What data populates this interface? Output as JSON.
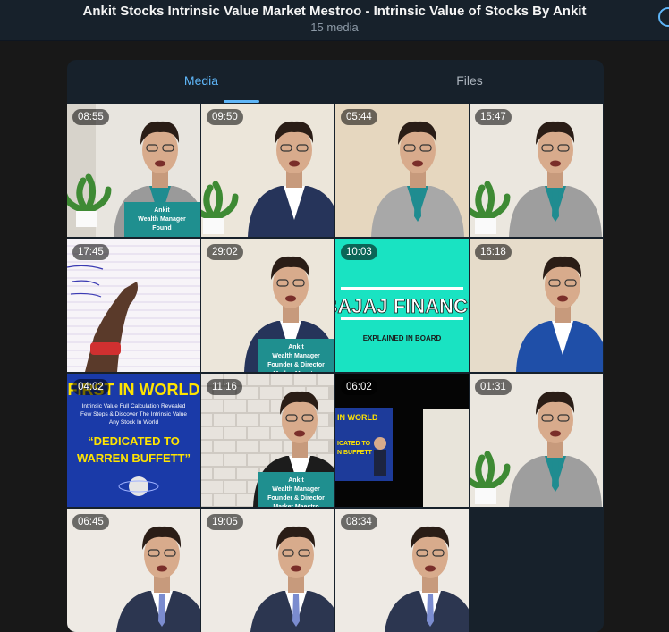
{
  "header": {
    "title": "Ankit Stocks Intrinsic Value Market Mestroo - Intrinsic Value of Stocks By Ankit",
    "subtitle": "15 media"
  },
  "tabs": [
    {
      "label": "Media",
      "active": true
    },
    {
      "label": "Files",
      "active": false
    }
  ],
  "media": [
    {
      "duration": "08:55",
      "style": "white-lower",
      "caption": [
        "Ankit",
        "Wealth Manager",
        "Found"
      ]
    },
    {
      "duration": "09:50",
      "style": "navy",
      "caption": []
    },
    {
      "duration": "05:44",
      "style": "grey",
      "caption": []
    },
    {
      "duration": "15:47",
      "style": "grey-plant",
      "caption": []
    },
    {
      "duration": "17:45",
      "style": "board",
      "caption": []
    },
    {
      "duration": "29:02",
      "style": "navy-lower",
      "caption": [
        "Ankit",
        "Wealth Manager",
        "Founder & Director",
        "Market Maestro"
      ]
    },
    {
      "duration": "10:03",
      "style": "teal-title",
      "caption": [
        "BAJAJ FINANCE",
        "EXPLAINED IN BOARD"
      ]
    },
    {
      "duration": "16:18",
      "style": "blue",
      "caption": []
    },
    {
      "duration": "04:02",
      "style": "poster",
      "caption": [
        "FIRST IN WORLD",
        "Intrinsic Value Full Calculation Revealed",
        "Few Steps & Discover The Intrinsic Value",
        "Any Stock In World",
        "“DEDICATED TO",
        "WARREN BUFFETT”"
      ]
    },
    {
      "duration": "11:16",
      "style": "brick-lower",
      "caption": [
        "Ankit",
        "Wealth Manager",
        "Founder & Director",
        "Market Maestro"
      ]
    },
    {
      "duration": "06:02",
      "style": "dark-tv",
      "caption": []
    },
    {
      "duration": "01:31",
      "style": "grey-plant",
      "caption": []
    },
    {
      "duration": "06:45",
      "style": "white-suit",
      "caption": []
    },
    {
      "duration": "19:05",
      "style": "white-suit",
      "caption": []
    },
    {
      "duration": "08:34",
      "style": "white-suit",
      "caption": []
    }
  ]
}
